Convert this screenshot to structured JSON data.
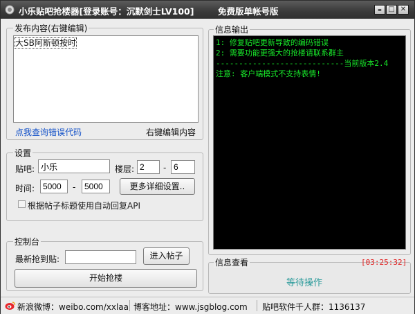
{
  "window": {
    "title": "小乐贴吧抢楼器[登录账号：沉默剑士LV100]",
    "title_free": "免费版单帐号版",
    "controls": {
      "minimize": "▬",
      "maximize": "□",
      "close": "✕"
    }
  },
  "publish": {
    "group_label": "发布内容(右键编辑)",
    "content": "大SB阿斯顿按时",
    "error_link": "点我查询错误代码",
    "right_click_hint": "右键编辑内容"
  },
  "settings": {
    "group_label": "设置",
    "tieba_label": "贴吧:",
    "tieba_value": "小乐",
    "floor_label": "楼层:",
    "floor_from": "2",
    "floor_dash": "-",
    "floor_to": "6",
    "time_label": "时间:",
    "time_from": "5000",
    "time_dash": "-",
    "time_to": "5000",
    "more_settings_button": "更多详细设置..",
    "auto_reply_checkbox_label": "根据帖子标题使用自动回复API",
    "auto_reply_checked": false
  },
  "console_group": {
    "group_label": "控制台",
    "latest_label": "最新抢到贴:",
    "latest_value": "",
    "enter_post_button": "进入帖子",
    "start_button": "开始抢楼"
  },
  "info_output": {
    "group_label": "信息输出",
    "lines": [
      "1: 修复贴吧更新导致的编码错误",
      "2: 需要功能更强大的抢楼请联系群主",
      "----------------------------当前版本2.4",
      "注意: 客户端模式不支持表情!"
    ]
  },
  "info_view": {
    "group_label": "信息查看",
    "timer": "[03:25:32]",
    "status": "等待操作"
  },
  "statusbar": {
    "weibo": "新浪微博：weibo.com/xxlaa",
    "blog": "博客地址：www.jsgblog.com",
    "qq_group": "贴吧软件千人群：1136137"
  },
  "colors": {
    "console_text": "#18e82a",
    "link": "#1452c8",
    "timer": "#e02020",
    "status": "#2a9a9a"
  }
}
